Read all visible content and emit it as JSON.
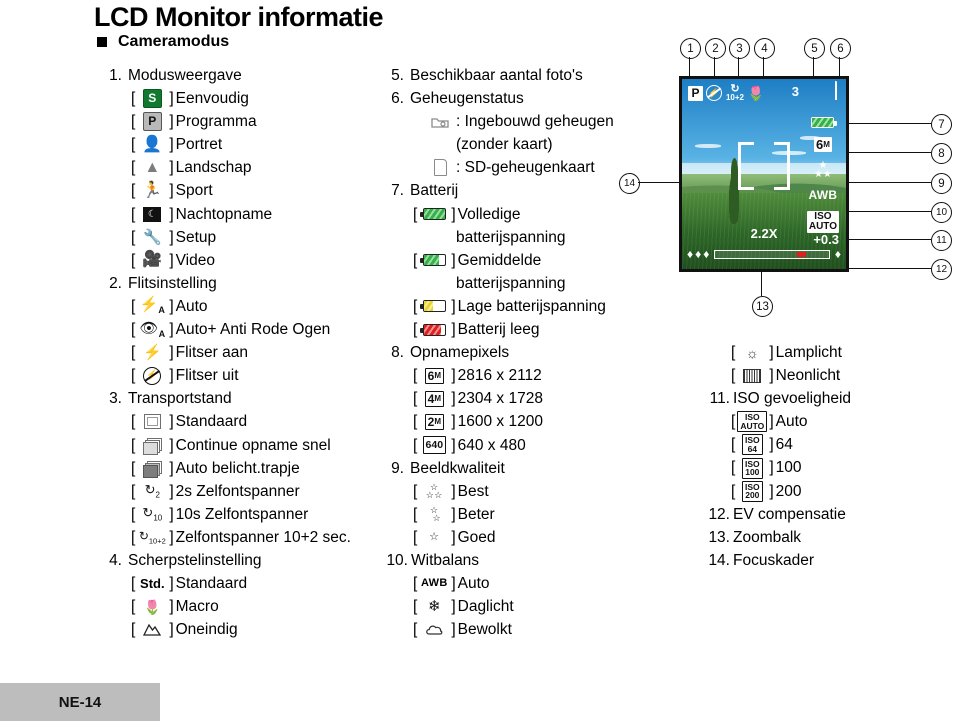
{
  "page": {
    "title": "LCD Monitor informatie",
    "section_heading": "Cameramodus",
    "footer_label": "NE-14"
  },
  "left_column": [
    {
      "num": "1.",
      "label": "Modusweergave",
      "items": [
        {
          "icon": "mode-simple-icon",
          "label": "Eenvoudig"
        },
        {
          "icon": "mode-program-icon",
          "label": "Programma"
        },
        {
          "icon": "mode-portrait-icon",
          "label": "Portret"
        },
        {
          "icon": "mode-landscape-icon",
          "label": "Landschap"
        },
        {
          "icon": "mode-sport-icon",
          "label": "Sport"
        },
        {
          "icon": "mode-night-icon",
          "label": "Nachtopname"
        },
        {
          "icon": "mode-setup-icon",
          "label": "Setup"
        },
        {
          "icon": "mode-video-icon",
          "label": "Video"
        }
      ]
    },
    {
      "num": "2.",
      "label": "Flitsinstelling",
      "items": [
        {
          "icon": "flash-auto-icon",
          "label": "Auto"
        },
        {
          "icon": "flash-red-eye-icon",
          "label": "Auto+ Anti Rode Ogen"
        },
        {
          "icon": "flash-on-icon",
          "label": "Flitser aan"
        },
        {
          "icon": "flash-off-icon",
          "label": "Flitser uit"
        }
      ]
    },
    {
      "num": "3.",
      "label": "Transportstand",
      "items": [
        {
          "icon": "drive-single-icon",
          "label": "Standaard"
        },
        {
          "icon": "drive-continuous-icon",
          "label": "Continue opname snel"
        },
        {
          "icon": "drive-bracket-icon",
          "label": "Auto belicht.trapje"
        },
        {
          "icon": "timer-2s-icon",
          "label": "2s Zelfontspanner"
        },
        {
          "icon": "timer-10s-icon",
          "label": "10s Zelfontspanner"
        },
        {
          "icon": "timer-10plus2-icon",
          "label": "Zelfontspanner 10+2 sec."
        }
      ]
    },
    {
      "num": "4.",
      "label": "Scherpstelinstelling",
      "items": [
        {
          "icon": "focus-standard-icon",
          "label": "Standaard"
        },
        {
          "icon": "focus-macro-icon",
          "label": "Macro"
        },
        {
          "icon": "focus-infinity-icon",
          "label": "Oneindig"
        }
      ]
    }
  ],
  "mid_column": {
    "item5": {
      "num": "5.",
      "label": "Beschikbaar aantal foto's"
    },
    "item6": {
      "num": "6.",
      "label": "Geheugenstatus",
      "memory": [
        {
          "icon": "internal-memory-icon",
          "label": ": Ingebouwd geheugen",
          "cont": "(zonder kaart)"
        },
        {
          "icon": "sd-card-icon",
          "label": ": SD-geheugenkaart",
          "cont": ""
        }
      ]
    },
    "item7": {
      "num": "7.",
      "label": "Batterij",
      "items": [
        {
          "icon": "battery-full-icon",
          "label": "Volledige",
          "cont": "batterijspanning"
        },
        {
          "icon": "battery-medium-icon",
          "label": "Gemiddelde",
          "cont": "batterijspanning"
        },
        {
          "icon": "battery-low-icon",
          "label": "Lage batterijspanning",
          "cont": ""
        },
        {
          "icon": "battery-empty-icon",
          "label": "Batterij leeg",
          "cont": ""
        }
      ]
    },
    "item8": {
      "num": "8.",
      "label": "Opnamepixels",
      "items": [
        {
          "icon": "px-6m-icon",
          "badge": "6",
          "unit": "M",
          "label": "2816 x 2112"
        },
        {
          "icon": "px-4m-icon",
          "badge": "4",
          "unit": "M",
          "label": "2304 x 1728"
        },
        {
          "icon": "px-2m-icon",
          "badge": "2",
          "unit": "M",
          "label": "1600 x 1200"
        },
        {
          "icon": "px-640-icon",
          "badge": "640",
          "unit": "",
          "label": "640 x 480"
        }
      ]
    },
    "item9": {
      "num": "9.",
      "label": "Beeldkwaliteit",
      "items": [
        {
          "icon": "quality-best-icon",
          "label": "Best"
        },
        {
          "icon": "quality-better-icon",
          "label": "Beter"
        },
        {
          "icon": "quality-good-icon",
          "label": "Goed"
        }
      ]
    },
    "item10": {
      "num": "10.",
      "label": "Witbalans",
      "items": [
        {
          "icon": "wb-auto-icon",
          "badge": "AWB",
          "label": "Auto"
        },
        {
          "icon": "wb-daylight-icon",
          "badge": "",
          "label": "Daglicht"
        },
        {
          "icon": "wb-cloudy-icon",
          "badge": "",
          "label": "Bewolkt"
        }
      ]
    }
  },
  "right_column": {
    "wb_extra": [
      {
        "icon": "wb-tungsten-icon",
        "label": "Lamplicht"
      },
      {
        "icon": "wb-fluorescent-icon",
        "label": "Neonlicht"
      }
    ],
    "item11": {
      "num": "11.",
      "label": "ISO gevoeligheid",
      "items": [
        {
          "icon": "iso-auto-icon",
          "top": "ISO",
          "bottom": "AUTO",
          "label": "Auto"
        },
        {
          "icon": "iso-64-icon",
          "top": "ISO",
          "bottom": "64",
          "label": "64"
        },
        {
          "icon": "iso-100-icon",
          "top": "ISO",
          "bottom": "100",
          "label": "100"
        },
        {
          "icon": "iso-200-icon",
          "top": "ISO",
          "bottom": "200",
          "label": "200"
        }
      ]
    },
    "item12": {
      "num": "12.",
      "label": "EV compensatie"
    },
    "item13": {
      "num": "13.",
      "label": "Zoombalk"
    },
    "item14": {
      "num": "14.",
      "label": "Focuskader"
    }
  },
  "lcd_figure": {
    "callouts": [
      "1",
      "2",
      "3",
      "4",
      "5",
      "6",
      "7",
      "8",
      "9",
      "10",
      "11",
      "12",
      "13",
      "14"
    ],
    "osd": {
      "mode": "P",
      "flash": "flash-off-icon",
      "timer": "10+2",
      "macro": "macro-icon",
      "shots_remaining": "3",
      "card": "sd-card-icon",
      "battery": "battery-full-icon",
      "pixels_badge": "6",
      "pixels_unit": "M",
      "quality_stars": "★★★",
      "white_balance": "AWB",
      "iso_top": "ISO",
      "iso_bottom": "AUTO",
      "ev": "+0.3",
      "zoom": "2.2X"
    }
  },
  "colors": {
    "simple_mode_green": "#127a2e",
    "battery_green": "#35b14a",
    "battery_yellow": "#e9d62a",
    "battery_red": "#e02020",
    "zoom_marker_red": "#e11d1d",
    "footer_gray": "#bdbdbd"
  }
}
